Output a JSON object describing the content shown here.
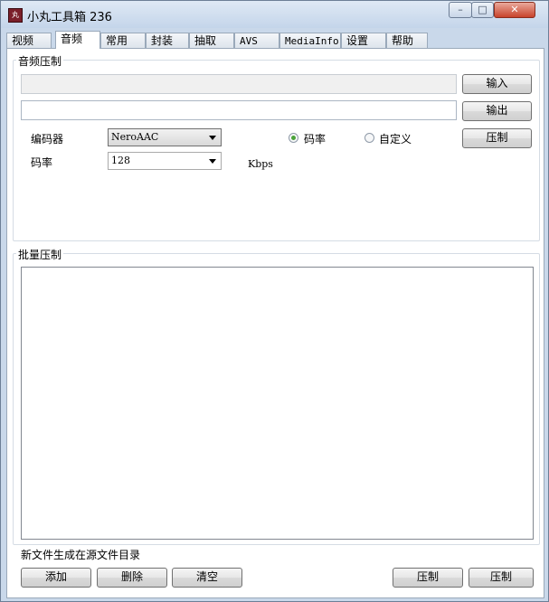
{
  "window": {
    "title": "小丸工具箱 236",
    "caption_buttons": {
      "minimize": "–",
      "maximize": "□",
      "close": "✕"
    }
  },
  "tabs": [
    {
      "label": "视频"
    },
    {
      "label": "音频",
      "active": true
    },
    {
      "label": "常用"
    },
    {
      "label": "封装"
    },
    {
      "label": "抽取"
    },
    {
      "label": "AVS"
    },
    {
      "label": "MediaInfo"
    },
    {
      "label": "设置"
    },
    {
      "label": "帮助"
    }
  ],
  "audio": {
    "group_label": "音频压制",
    "input_value": "",
    "output_value": "",
    "input_button": "输入",
    "output_button": "输出",
    "encode_button": "压制",
    "codec_label": "编码器",
    "codec_value": "NeroAAC",
    "bitrate_label": "码率",
    "bitrate_value": "128",
    "bitrate_unit": "Kbps",
    "radio_bitrate": "码率",
    "radio_custom": "自定义"
  },
  "batch": {
    "group_label": "批量压制",
    "note": "新文件生成在源文件目录",
    "add_button": "添加",
    "delete_button": "删除",
    "clear_button": "清空",
    "right_button_1": "压制",
    "right_button_2": "压制"
  }
}
